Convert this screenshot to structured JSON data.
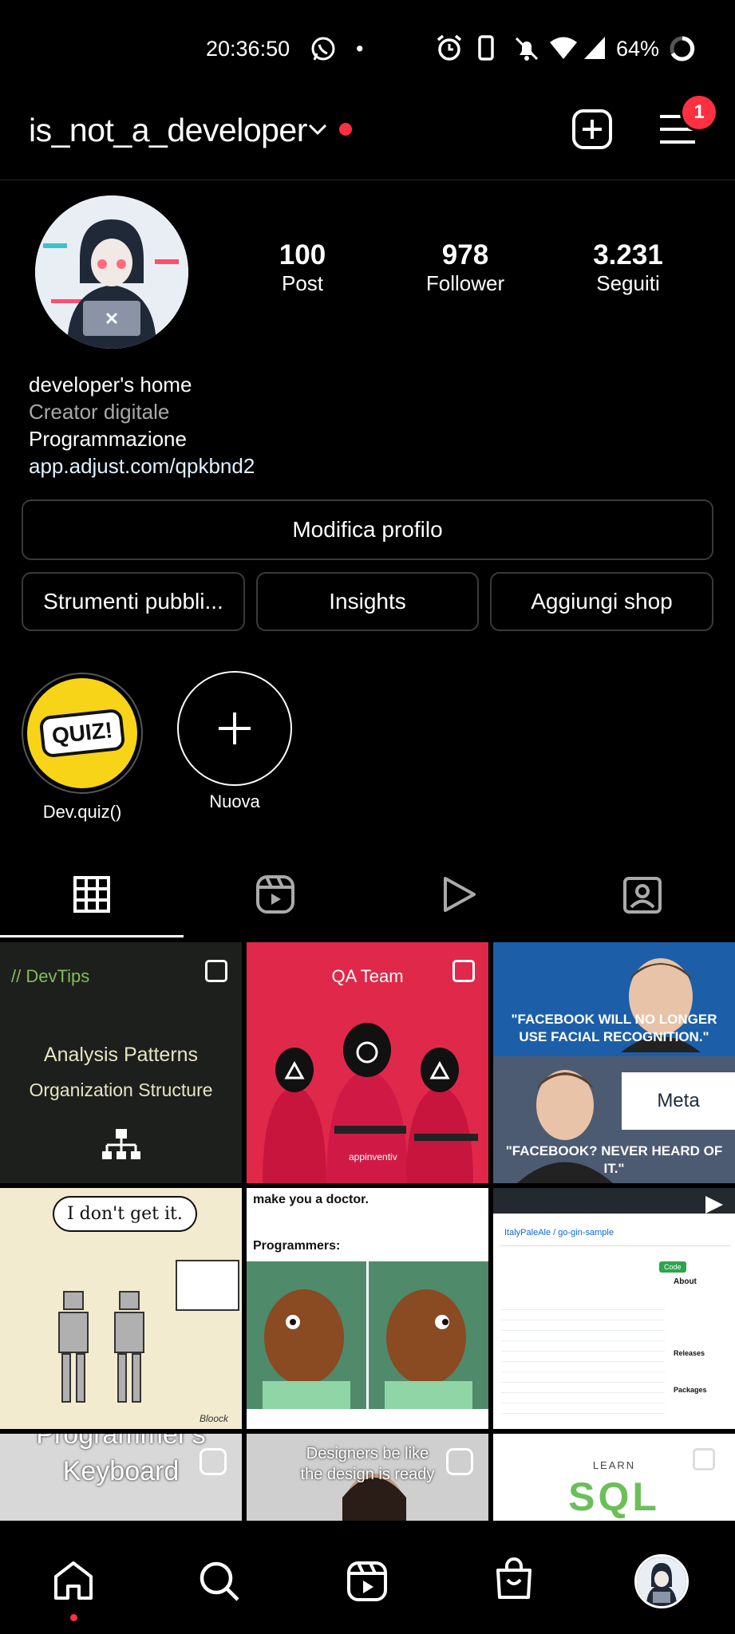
{
  "status_bar": {
    "time": "20:36:50",
    "dot": "•",
    "battery": "64%"
  },
  "header": {
    "username": "is_not_a_developer",
    "notification_count": "1"
  },
  "profile": {
    "posts": {
      "count": "100",
      "label": "Post"
    },
    "followers": {
      "count": "978",
      "label": "Follower"
    },
    "following": {
      "count": "3.231",
      "label": "Seguiti"
    },
    "bio": {
      "name": "developer's home",
      "category": "Creator digitale",
      "text": "Programmazione",
      "link": "app.adjust.com/qpkbnd2"
    }
  },
  "buttons": {
    "edit_profile": "Modifica profilo",
    "tools": "Strumenti pubbli...",
    "insights": "Insights",
    "add_shop": "Aggiungi shop"
  },
  "highlights": [
    {
      "label": "Dev.quiz()",
      "cover_text": "QUIZ!"
    },
    {
      "label": "Nuova"
    }
  ],
  "grid": {
    "t1": {
      "tag": "// DevTips",
      "line1": "Analysis Patterns",
      "line2": "Organization Structure"
    },
    "t2": {
      "title": "QA Team",
      "brand": "appinventiv"
    },
    "t3": {
      "quote1": "\"FACEBOOK WILL NO LONGER USE FACIAL RECOGNITION.\"",
      "meta": "Meta",
      "quote2": "\"FACEBOOK? NEVER HEARD OF IT.\""
    },
    "t4": {
      "speech": "I don't get it.",
      "sign": "Bloock"
    },
    "t5": {
      "line1": "make you a doctor.",
      "line2": "Programmers:"
    },
    "t6": {
      "repo": "ItalyPaleAle / go-gin-sample",
      "about": "About",
      "releases": "Releases",
      "packages": "Packages",
      "code_btn": "Code"
    },
    "t7": {
      "line1": "Programmer's",
      "line2": "Keyboard"
    },
    "t8": {
      "line1": "Designers be like",
      "line2": "the design is ready"
    },
    "t9": {
      "small": "LEARN",
      "big": "SQL"
    }
  },
  "colors": {
    "accent_red": "#ff3040",
    "border": "#3a3a3a",
    "divider": "#262626"
  }
}
